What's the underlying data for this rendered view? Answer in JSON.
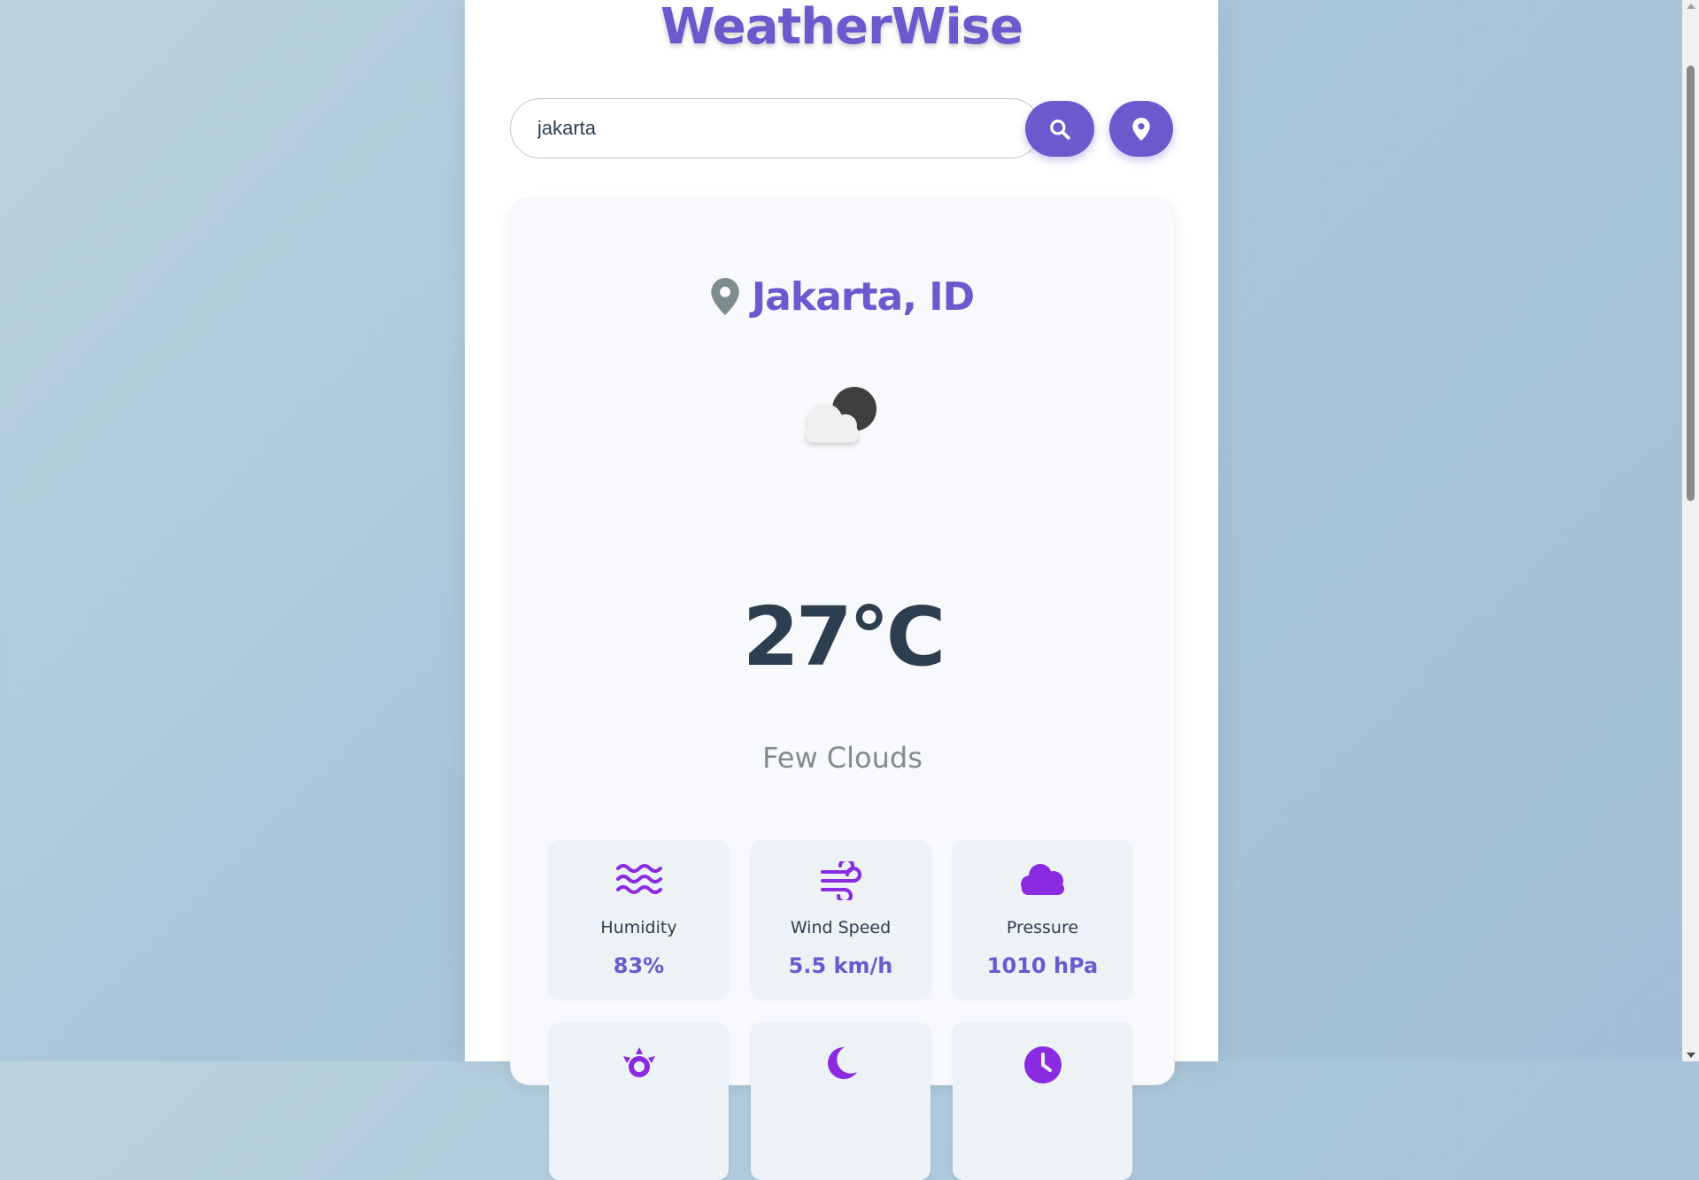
{
  "app": {
    "title": "WeatherWise"
  },
  "search": {
    "value": "jakarta",
    "search_icon": "search-icon",
    "location_icon": "location-pin-icon"
  },
  "weather": {
    "location": "Jakarta, ID",
    "location_icon": "location-pin-icon",
    "condition_icon": "few-clouds-night-icon",
    "temperature": "27°C",
    "description": "Few Clouds"
  },
  "details": [
    {
      "icon": "water-waves-icon",
      "label": "Humidity",
      "value": "83%"
    },
    {
      "icon": "wind-icon",
      "label": "Wind Speed",
      "value": "5.5 km/h"
    },
    {
      "icon": "cloud-icon",
      "label": "Pressure",
      "value": "1010 hPa"
    },
    {
      "icon": "sun-icon"
    },
    {
      "icon": "moon-icon"
    },
    {
      "icon": "clock-icon"
    }
  ],
  "colors": {
    "accent": "#6a5acd",
    "icon_purple": "#8a2be2",
    "text_dark": "#2c3e50",
    "text_muted": "#7f8c8d"
  }
}
